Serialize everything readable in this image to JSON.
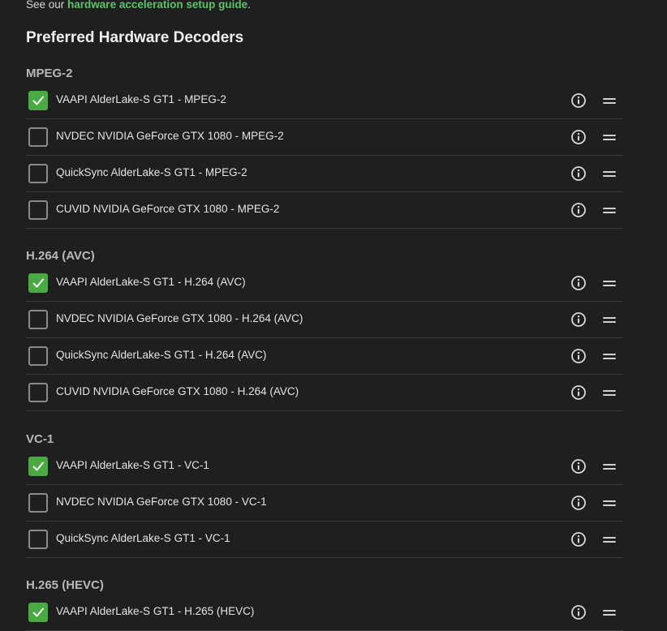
{
  "intro": {
    "prefix": "See our ",
    "link": "hardware acceleration setup guide",
    "suffix": "."
  },
  "title": "Preferred Hardware Decoders",
  "groups": [
    {
      "name": "MPEG-2",
      "items": [
        {
          "label": "VAAPI AlderLake-S GT1 - MPEG-2",
          "checked": true
        },
        {
          "label": "NVDEC NVIDIA GeForce GTX 1080 - MPEG-2",
          "checked": false
        },
        {
          "label": "QuickSync AlderLake-S GT1 - MPEG-2",
          "checked": false
        },
        {
          "label": "CUVID NVIDIA GeForce GTX 1080 - MPEG-2",
          "checked": false
        }
      ]
    },
    {
      "name": "H.264 (AVC)",
      "items": [
        {
          "label": "VAAPI AlderLake-S GT1 - H.264 (AVC)",
          "checked": true
        },
        {
          "label": "NVDEC NVIDIA GeForce GTX 1080 - H.264 (AVC)",
          "checked": false
        },
        {
          "label": "QuickSync AlderLake-S GT1 - H.264 (AVC)",
          "checked": false
        },
        {
          "label": "CUVID NVIDIA GeForce GTX 1080 - H.264 (AVC)",
          "checked": false
        }
      ]
    },
    {
      "name": "VC-1",
      "items": [
        {
          "label": "VAAPI AlderLake-S GT1 - VC-1",
          "checked": true
        },
        {
          "label": "NVDEC NVIDIA GeForce GTX 1080 - VC-1",
          "checked": false
        },
        {
          "label": "QuickSync AlderLake-S GT1 - VC-1",
          "checked": false
        }
      ]
    },
    {
      "name": "H.265 (HEVC)",
      "items": [
        {
          "label": "VAAPI AlderLake-S GT1 - H.265 (HEVC)",
          "checked": true
        }
      ]
    }
  ],
  "icons": {
    "info": "info-circle-icon",
    "drag": "drag-handle-icon",
    "check": "checkmark-icon"
  },
  "colors": {
    "background": "#1f1f1f",
    "accent": "#49a942",
    "link": "#5fc36a",
    "divider": "#3a3a3a"
  }
}
